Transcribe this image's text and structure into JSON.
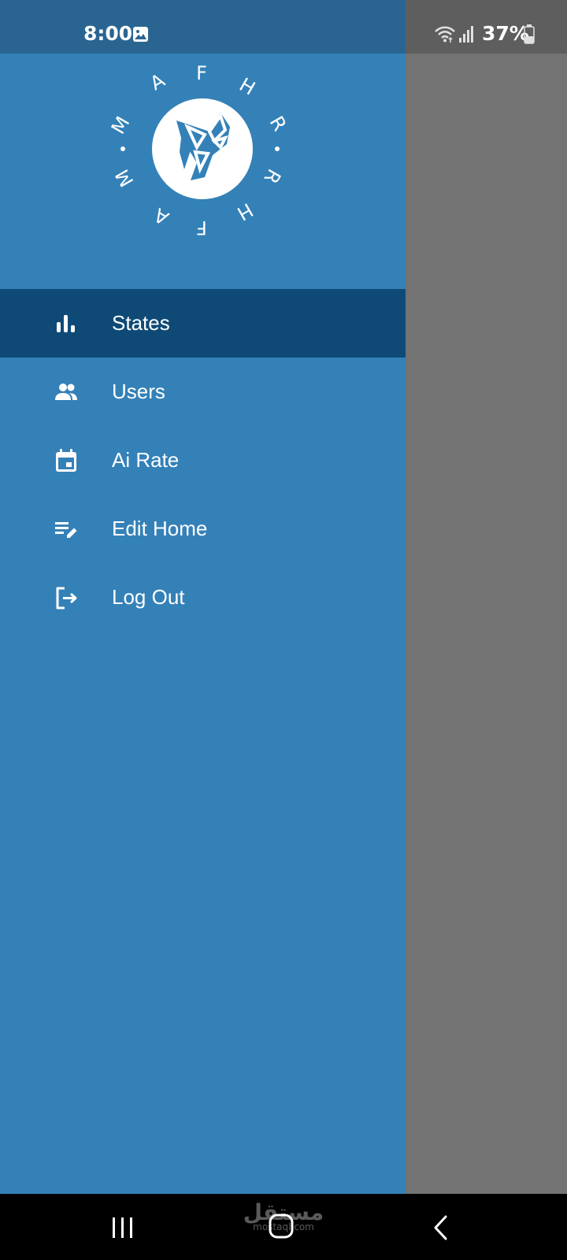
{
  "status_bar": {
    "time": "8:00",
    "battery_percent": "37%",
    "icons": [
      "gallery-icon",
      "wifi-icon",
      "signal-icon",
      "battery-icon"
    ]
  },
  "drawer": {
    "logo": {
      "ring_letters_top": [
        "M",
        "A",
        "F",
        "H",
        "R"
      ],
      "ring_letters_bottom": [
        "M",
        "A",
        "F",
        "H",
        "R"
      ],
      "icon": "crystal-logo-icon"
    },
    "menu": [
      {
        "label": "States",
        "icon": "bar-chart-icon",
        "active": true
      },
      {
        "label": "Users",
        "icon": "people-icon",
        "active": false
      },
      {
        "label": "Ai Rate",
        "icon": "calendar-icon",
        "active": false
      },
      {
        "label": "Edit Home",
        "icon": "edit-list-icon",
        "active": false
      },
      {
        "label": "Log Out",
        "icon": "logout-icon",
        "active": false
      }
    ]
  },
  "nav_bar": {
    "watermark_arabic": "مستقل",
    "watermark_latin": "mostaql.com",
    "icons": [
      "recents-icon",
      "home-icon",
      "back-icon"
    ]
  },
  "colors": {
    "drawer": "#3481b8",
    "drawer_status": "#2a6592",
    "active_item": "#0f4a77",
    "scrim": "#737373",
    "nav": "#000000"
  }
}
